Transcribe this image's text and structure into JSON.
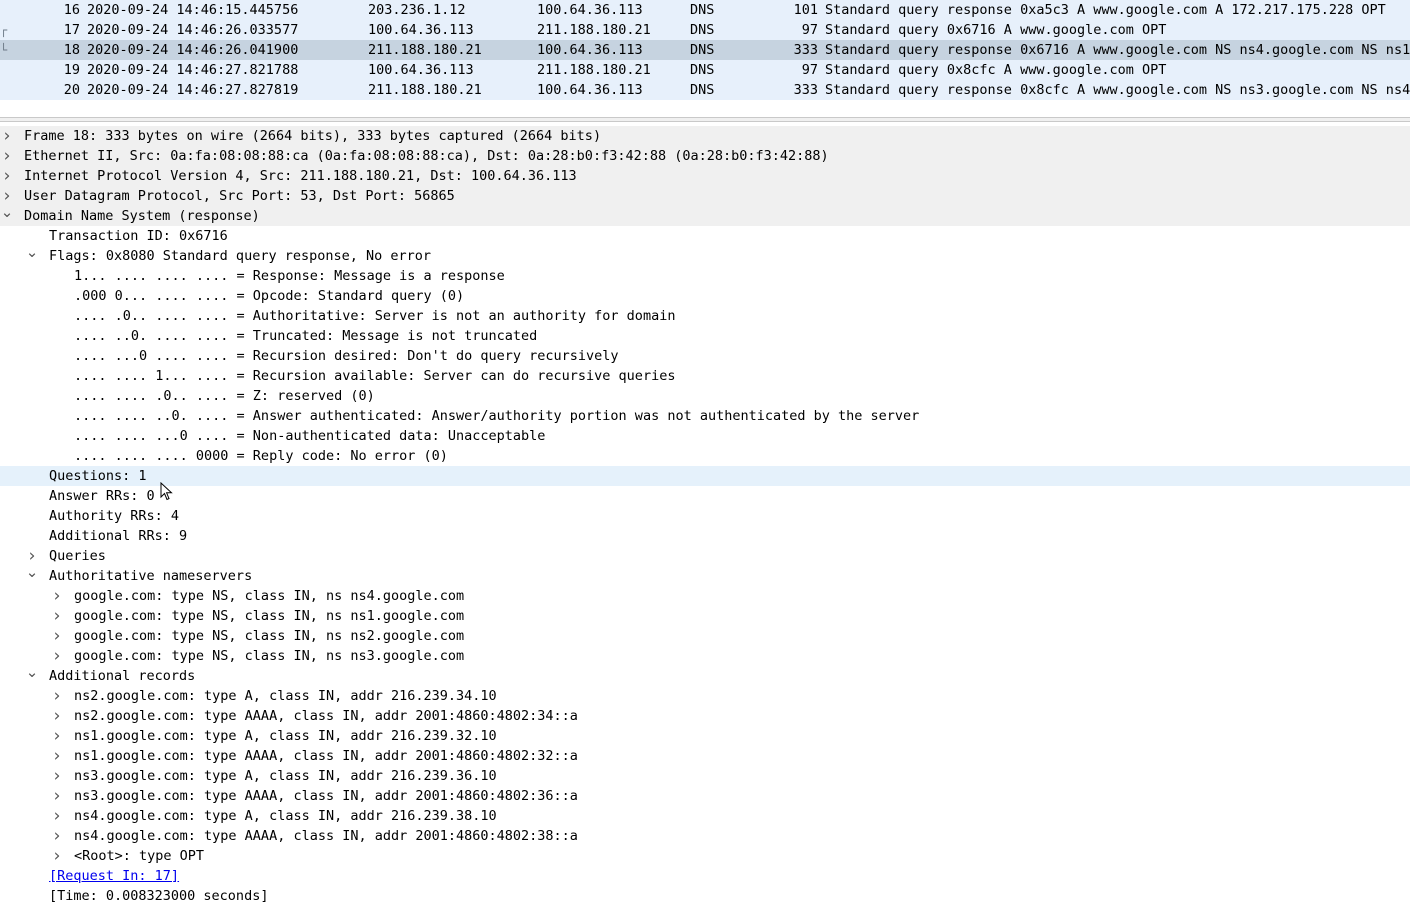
{
  "packet_list": {
    "rows": [
      {
        "no": "16",
        "time": "2020-09-24 14:46:15.445756",
        "source": "203.236.1.12",
        "destination": "100.64.36.113",
        "protocol": "DNS",
        "length": "101",
        "info": "Standard query response 0xa5c3 A www.google.com A 172.217.175.228 OPT",
        "selected": false
      },
      {
        "no": "17",
        "time": "2020-09-24 14:46:26.033577",
        "source": "100.64.36.113",
        "destination": "211.188.180.21",
        "protocol": "DNS",
        "length": "97",
        "info": "Standard query 0x6716 A www.google.com OPT",
        "selected": false
      },
      {
        "no": "18",
        "time": "2020-09-24 14:46:26.041900",
        "source": "211.188.180.21",
        "destination": "100.64.36.113",
        "protocol": "DNS",
        "length": "333",
        "info": "Standard query response 0x6716 A www.google.com NS ns4.google.com NS ns1.",
        "selected": true
      },
      {
        "no": "19",
        "time": "2020-09-24 14:46:27.821788",
        "source": "100.64.36.113",
        "destination": "211.188.180.21",
        "protocol": "DNS",
        "length": "97",
        "info": "Standard query 0x8cfc A www.google.com OPT",
        "selected": false
      },
      {
        "no": "20",
        "time": "2020-09-24 14:46:27.827819",
        "source": "211.188.180.21",
        "destination": "100.64.36.113",
        "protocol": "DNS",
        "length": "333",
        "info": "Standard query response 0x8cfc A www.google.com NS ns3.google.com NS ns4.",
        "selected": false
      }
    ]
  },
  "details": {
    "rows": [
      {
        "name": "frame-node",
        "level": 0,
        "arrow": "right",
        "text": "Frame 18: 333 bytes on wire (2664 bits), 333 bytes captured (2664 bits)",
        "shaded": true
      },
      {
        "name": "ethernet-node",
        "level": 0,
        "arrow": "right",
        "text": "Ethernet II, Src: 0a:fa:08:08:88:ca (0a:fa:08:08:88:ca), Dst: 0a:28:b0:f3:42:88 (0a:28:b0:f3:42:88)",
        "shaded": true
      },
      {
        "name": "ip-node",
        "level": 0,
        "arrow": "right",
        "text": "Internet Protocol Version 4, Src: 211.188.180.21, Dst: 100.64.36.113",
        "shaded": true
      },
      {
        "name": "udp-node",
        "level": 0,
        "arrow": "right",
        "text": "User Datagram Protocol, Src Port: 53, Dst Port: 56865",
        "shaded": true
      },
      {
        "name": "dns-node",
        "level": 0,
        "arrow": "down",
        "text": "Domain Name System (response)",
        "shaded": true
      },
      {
        "name": "transaction-id-field",
        "level": 1,
        "arrow": "none",
        "text": "Transaction ID: 0x6716"
      },
      {
        "name": "flags-node",
        "level": 1,
        "arrow": "down",
        "text": "Flags: 0x8080 Standard query response, No error"
      },
      {
        "name": "flag-response",
        "level": 2,
        "arrow": "none",
        "text": "1... .... .... .... = Response: Message is a response"
      },
      {
        "name": "flag-opcode",
        "level": 2,
        "arrow": "none",
        "text": ".000 0... .... .... = Opcode: Standard query (0)"
      },
      {
        "name": "flag-authoritative",
        "level": 2,
        "arrow": "none",
        "text": ".... .0.. .... .... = Authoritative: Server is not an authority for domain"
      },
      {
        "name": "flag-truncated",
        "level": 2,
        "arrow": "none",
        "text": ".... ..0. .... .... = Truncated: Message is not truncated"
      },
      {
        "name": "flag-recursion-desired",
        "level": 2,
        "arrow": "none",
        "text": ".... ...0 .... .... = Recursion desired: Don't do query recursively"
      },
      {
        "name": "flag-recursion-available",
        "level": 2,
        "arrow": "none",
        "text": ".... .... 1... .... = Recursion available: Server can do recursive queries"
      },
      {
        "name": "flag-z",
        "level": 2,
        "arrow": "none",
        "text": ".... .... .0.. .... = Z: reserved (0)"
      },
      {
        "name": "flag-answer-authenticated",
        "level": 2,
        "arrow": "none",
        "text": ".... .... ..0. .... = Answer authenticated: Answer/authority portion was not authenticated by the server"
      },
      {
        "name": "flag-non-authenticated",
        "level": 2,
        "arrow": "none",
        "text": ".... .... ...0 .... = Non-authenticated data: Unacceptable"
      },
      {
        "name": "flag-reply-code",
        "level": 2,
        "arrow": "none",
        "text": ".... .... .... 0000 = Reply code: No error (0)"
      },
      {
        "name": "questions-field",
        "level": 1,
        "arrow": "none",
        "text": "Questions: 1",
        "hover": true
      },
      {
        "name": "answer-rrs-field",
        "level": 1,
        "arrow": "none",
        "text": "Answer RRs: 0"
      },
      {
        "name": "authority-rrs-field",
        "level": 1,
        "arrow": "none",
        "text": "Authority RRs: 4"
      },
      {
        "name": "additional-rrs-field",
        "level": 1,
        "arrow": "none",
        "text": "Additional RRs: 9"
      },
      {
        "name": "queries-node",
        "level": 1,
        "arrow": "right",
        "text": "Queries"
      },
      {
        "name": "authoritative-nameservers-node",
        "level": 1,
        "arrow": "down",
        "text": "Authoritative nameservers"
      },
      {
        "name": "ns-record",
        "level": 2,
        "arrow": "right",
        "text": "google.com: type NS, class IN, ns ns4.google.com"
      },
      {
        "name": "ns-record",
        "level": 2,
        "arrow": "right",
        "text": "google.com: type NS, class IN, ns ns1.google.com"
      },
      {
        "name": "ns-record",
        "level": 2,
        "arrow": "right",
        "text": "google.com: type NS, class IN, ns ns2.google.com"
      },
      {
        "name": "ns-record",
        "level": 2,
        "arrow": "right",
        "text": "google.com: type NS, class IN, ns ns3.google.com"
      },
      {
        "name": "additional-records-node",
        "level": 1,
        "arrow": "down",
        "text": "Additional records"
      },
      {
        "name": "additional-record",
        "level": 2,
        "arrow": "right",
        "text": "ns2.google.com: type A, class IN, addr 216.239.34.10"
      },
      {
        "name": "additional-record",
        "level": 2,
        "arrow": "right",
        "text": "ns2.google.com: type AAAA, class IN, addr 2001:4860:4802:34::a"
      },
      {
        "name": "additional-record",
        "level": 2,
        "arrow": "right",
        "text": "ns1.google.com: type A, class IN, addr 216.239.32.10"
      },
      {
        "name": "additional-record",
        "level": 2,
        "arrow": "right",
        "text": "ns1.google.com: type AAAA, class IN, addr 2001:4860:4802:32::a"
      },
      {
        "name": "additional-record",
        "level": 2,
        "arrow": "right",
        "text": "ns3.google.com: type A, class IN, addr 216.239.36.10"
      },
      {
        "name": "additional-record",
        "level": 2,
        "arrow": "right",
        "text": "ns3.google.com: type AAAA, class IN, addr 2001:4860:4802:36::a"
      },
      {
        "name": "additional-record",
        "level": 2,
        "arrow": "right",
        "text": "ns4.google.com: type A, class IN, addr 216.239.38.10"
      },
      {
        "name": "additional-record",
        "level": 2,
        "arrow": "right",
        "text": "ns4.google.com: type AAAA, class IN, addr 2001:4860:4802:38::a"
      },
      {
        "name": "additional-record-opt",
        "level": 2,
        "arrow": "right",
        "text": "<Root>: type OPT"
      },
      {
        "name": "request-in-link",
        "level": 1,
        "arrow": "none",
        "text": "[Request In: 17]",
        "link": true
      },
      {
        "name": "time-field",
        "level": 1,
        "arrow": "none",
        "text": "[Time: 0.008323000 seconds]"
      }
    ]
  },
  "icons": {
    "expanded": "chevron-down-icon",
    "collapsed": "chevron-right-icon",
    "cursor": "mouse-pointer-icon"
  },
  "colors": {
    "packet_row_bg": "#e7f0fb",
    "selected_row_bg": "#c6d3e0",
    "link": "#0000ee",
    "hover_row_bg": "#e5f1fb"
  }
}
